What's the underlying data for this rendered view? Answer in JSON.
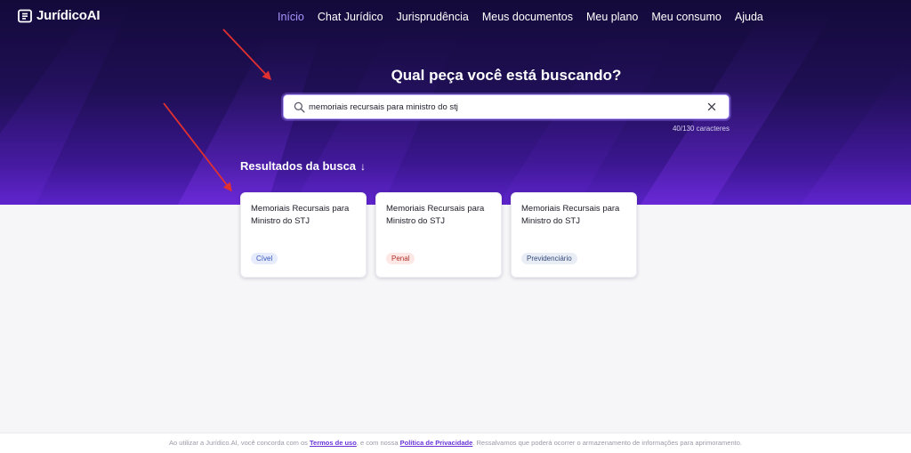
{
  "app": {
    "name": "JurídicoAI"
  },
  "nav": {
    "items": [
      {
        "label": "Início",
        "active": true
      },
      {
        "label": "Chat Jurídico",
        "active": false
      },
      {
        "label": "Jurisprudência",
        "active": false
      },
      {
        "label": "Meus documentos",
        "active": false
      },
      {
        "label": "Meu plano",
        "active": false
      },
      {
        "label": "Meu consumo",
        "active": false
      },
      {
        "label": "Ajuda",
        "active": false
      }
    ]
  },
  "hero": {
    "headline": "Qual peça você está buscando?"
  },
  "search": {
    "value": "memoriais recursais para ministro do stj",
    "char_count": "40/130 caracteres",
    "icon": "search-icon",
    "clear_icon": "close-icon"
  },
  "results": {
    "title": "Resultados da busca",
    "arrow": "↓",
    "cards": [
      {
        "title": "Memoriais Recursais para Ministro do STJ",
        "tag": "Cível"
      },
      {
        "title": "Memoriais Recursais para Ministro do STJ",
        "tag": "Penal"
      },
      {
        "title": "Memoriais Recursais para Ministro do STJ",
        "tag": "Previdenciário"
      }
    ]
  },
  "footer": {
    "prefix": "Ao utilizar a Jurídico.AI, você concorda com os",
    "terms": "Termos de uso",
    "middle": ", e com nossa",
    "privacy": "Política de Privacidade",
    "suffix": ". Ressalvamos que poderá ocorrer o armazenamento de informações para aprimoramento."
  },
  "colors": {
    "accent": "#a996ff",
    "hero_dark": "#140a3a",
    "hero_light": "#5a22c8",
    "annotation_arrow": "#e03030"
  }
}
